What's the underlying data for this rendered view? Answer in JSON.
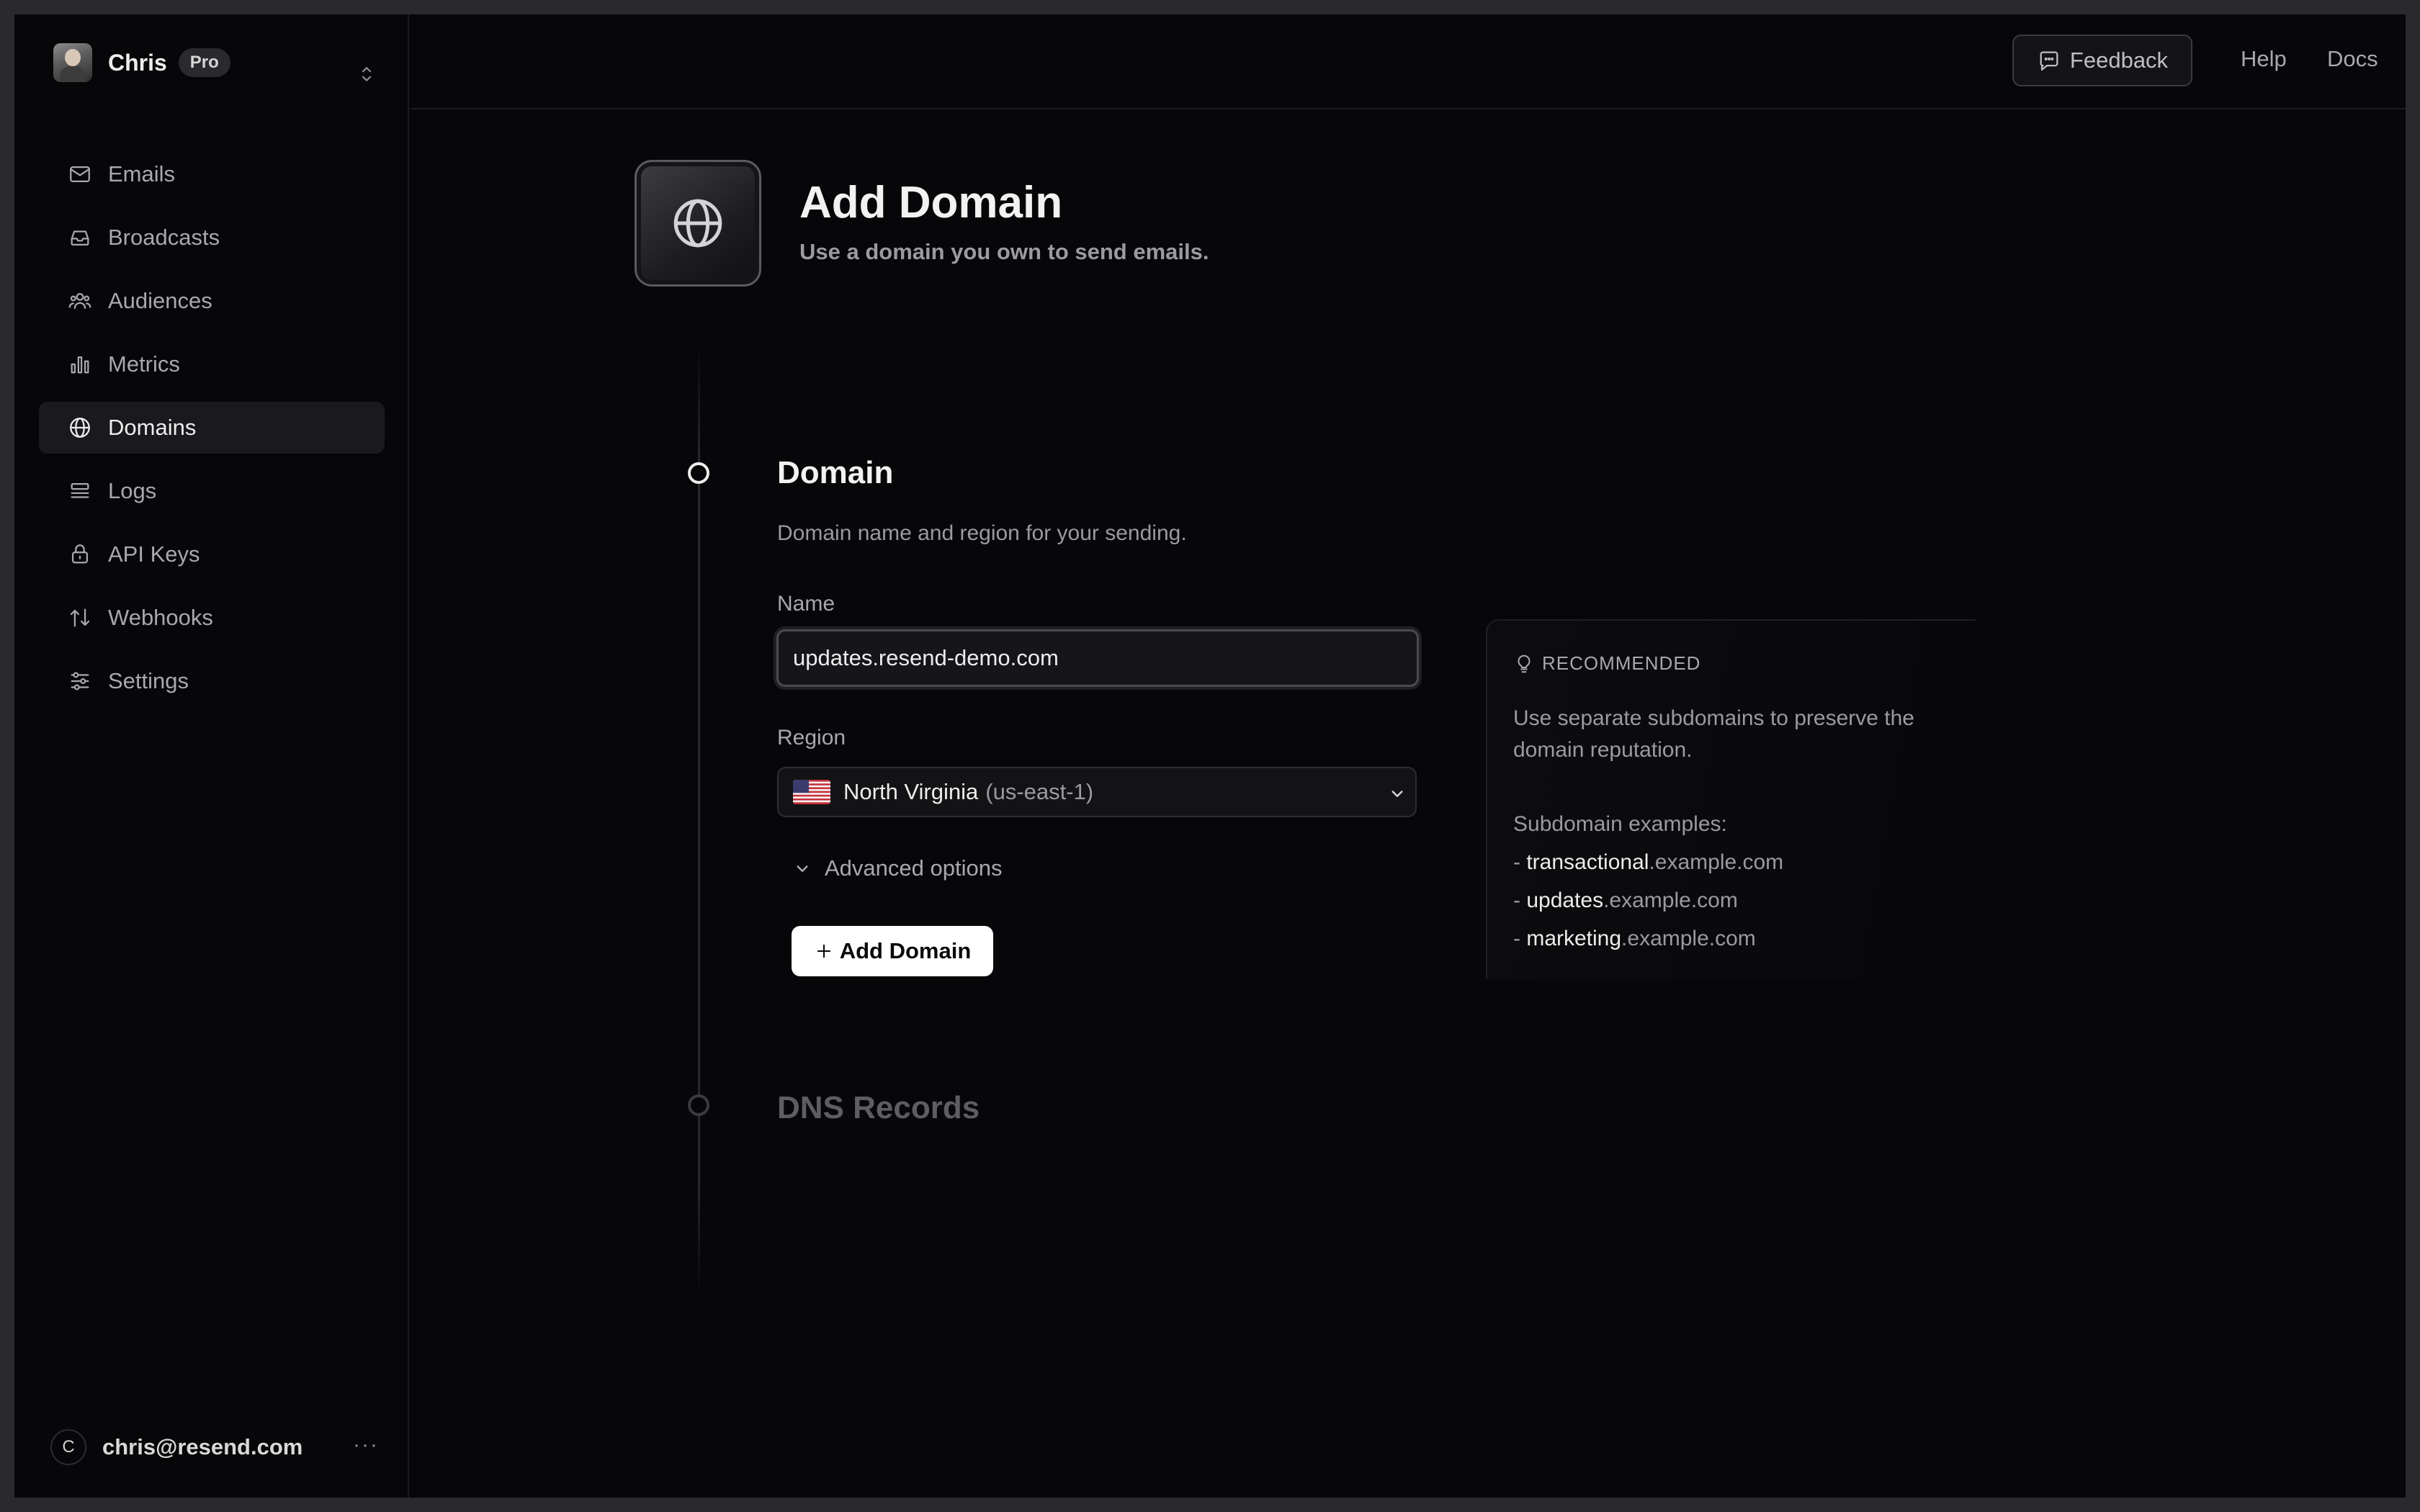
{
  "team": {
    "name": "Chris",
    "plan": "Pro"
  },
  "nav": {
    "items": [
      {
        "label": "Emails",
        "icon": "mail-icon"
      },
      {
        "label": "Broadcasts",
        "icon": "inbox-icon"
      },
      {
        "label": "Audiences",
        "icon": "users-icon"
      },
      {
        "label": "Metrics",
        "icon": "bar-chart-icon"
      },
      {
        "label": "Domains",
        "icon": "globe-icon",
        "active": true
      },
      {
        "label": "Logs",
        "icon": "logs-icon"
      },
      {
        "label": "API Keys",
        "icon": "lock-icon"
      },
      {
        "label": "Webhooks",
        "icon": "arrows-icon"
      },
      {
        "label": "Settings",
        "icon": "sliders-icon"
      }
    ]
  },
  "user": {
    "initial": "C",
    "email": "chris@resend.com",
    "more": "···"
  },
  "topbar": {
    "feedback": "Feedback",
    "help": "Help",
    "docs": "Docs"
  },
  "page": {
    "title": "Add Domain",
    "subtitle": "Use a domain you own to send emails."
  },
  "domain_step": {
    "title": "Domain",
    "description": "Domain name and region for your sending.",
    "name_label": "Name",
    "name_value": "updates.resend-demo.com",
    "region_label": "Region",
    "region_name": "North Virginia",
    "region_code": "(us-east-1)",
    "advanced_label": "Advanced options",
    "submit_label": "Add Domain"
  },
  "dns_step": {
    "title": "DNS Records"
  },
  "recommended": {
    "heading": "RECOMMENDED",
    "text": "Use separate subdomains to preserve the domain reputation.",
    "examples_label": "Subdomain examples:",
    "examples": [
      {
        "sub": "transactional",
        "domain": ".example.com"
      },
      {
        "sub": "updates",
        "domain": ".example.com"
      },
      {
        "sub": "marketing",
        "domain": ".example.com"
      }
    ]
  },
  "colors": {
    "background": "#07070a",
    "accent": "#ffffff",
    "muted": "#9a9aa0"
  }
}
